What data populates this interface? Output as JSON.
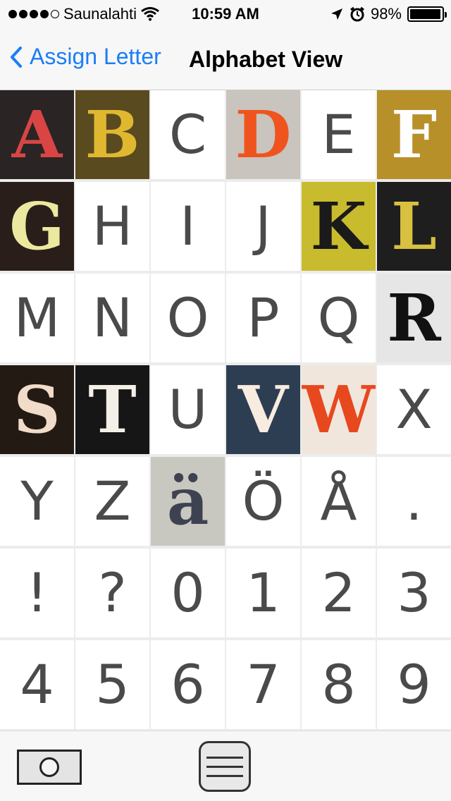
{
  "status_bar": {
    "carrier": "Saunalahti",
    "time": "10:59 AM",
    "battery": "98%",
    "battery_level": 0.98,
    "signal_bars_filled": 4,
    "signal_bars_total": 5
  },
  "nav": {
    "back_label": "Assign Letter",
    "title": "Alphabet View",
    "accent_color": "#1a7ef5"
  },
  "tiles": [
    {
      "char": "A",
      "style": "photo",
      "bg": "#2a2424",
      "fg": "#d94545"
    },
    {
      "char": "B",
      "style": "photo",
      "bg": "#5a4a20",
      "fg": "#e0b830"
    },
    {
      "char": "C",
      "style": "plain"
    },
    {
      "char": "D",
      "style": "photo",
      "bg": "#c9c4bd",
      "fg": "#f0541e"
    },
    {
      "char": "E",
      "style": "plain"
    },
    {
      "char": "F",
      "style": "photo",
      "bg": "#b8902a",
      "fg": "#ffffff"
    },
    {
      "char": "G",
      "style": "photo",
      "bg": "#2a1e1a",
      "fg": "#ece8a0"
    },
    {
      "char": "H",
      "style": "plain"
    },
    {
      "char": "I",
      "style": "plain"
    },
    {
      "char": "J",
      "style": "plain"
    },
    {
      "char": "K",
      "style": "photo",
      "bg": "#c8bb2e",
      "fg": "#1a1a1a"
    },
    {
      "char": "L",
      "style": "photo",
      "bg": "#1e1e1e",
      "fg": "#d8c040"
    },
    {
      "char": "M",
      "style": "plain"
    },
    {
      "char": "N",
      "style": "plain"
    },
    {
      "char": "O",
      "style": "plain"
    },
    {
      "char": "P",
      "style": "plain"
    },
    {
      "char": "Q",
      "style": "plain"
    },
    {
      "char": "R",
      "style": "photo",
      "bg": "#e6e6e6",
      "fg": "#111111"
    },
    {
      "char": "S",
      "style": "photo",
      "bg": "#241a14",
      "fg": "#f0dcc8"
    },
    {
      "char": "T",
      "style": "photo",
      "bg": "#161616",
      "fg": "#f4f0e8"
    },
    {
      "char": "U",
      "style": "plain"
    },
    {
      "char": "V",
      "style": "photo",
      "bg": "#2e3e52",
      "fg": "#f8ece0"
    },
    {
      "char": "W",
      "style": "photo",
      "bg": "#f0e6dc",
      "fg": "#e8481e"
    },
    {
      "char": "X",
      "style": "plain"
    },
    {
      "char": "Y",
      "style": "plain"
    },
    {
      "char": "Z",
      "style": "plain"
    },
    {
      "char": "ä",
      "style": "photo",
      "bg": "#c8c8c0",
      "fg": "#3e4250"
    },
    {
      "char": "Ö",
      "style": "plain"
    },
    {
      "char": "Å",
      "style": "plain"
    },
    {
      "char": ".",
      "style": "plain"
    },
    {
      "char": "!",
      "style": "plain"
    },
    {
      "char": "?",
      "style": "plain"
    },
    {
      "char": "0",
      "style": "plain"
    },
    {
      "char": "1",
      "style": "plain"
    },
    {
      "char": "2",
      "style": "plain"
    },
    {
      "char": "3",
      "style": "plain"
    },
    {
      "char": "4",
      "style": "plain"
    },
    {
      "char": "5",
      "style": "plain"
    },
    {
      "char": "6",
      "style": "plain"
    },
    {
      "char": "7",
      "style": "plain"
    },
    {
      "char": "8",
      "style": "plain"
    },
    {
      "char": "9",
      "style": "plain"
    }
  ],
  "toolbar": {
    "camera_icon": "camera-icon",
    "menu_icon": "menu-icon"
  }
}
